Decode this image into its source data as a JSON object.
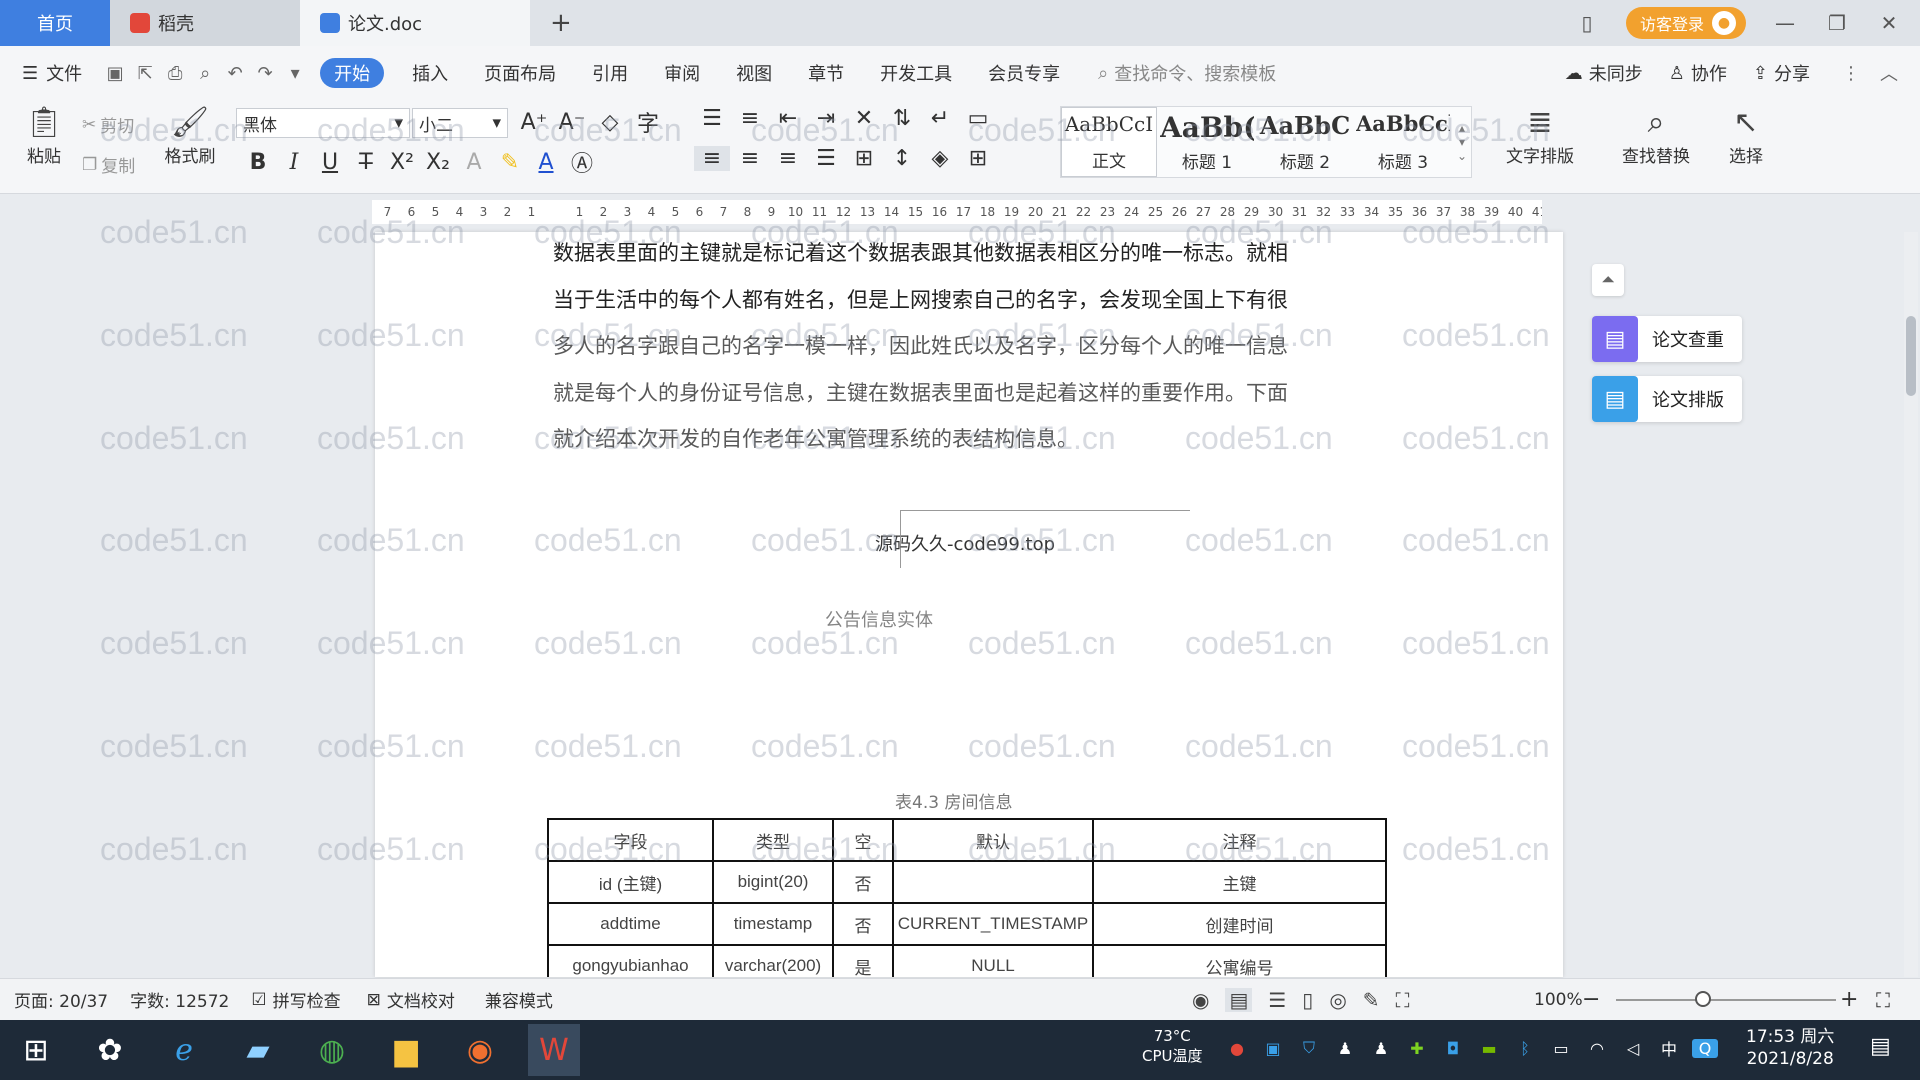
{
  "tabs": {
    "home": "首页",
    "daoke": "稻壳",
    "doc": "论文.doc",
    "add": "+"
  },
  "window": {
    "login": "访客登录"
  },
  "menu": {
    "file": "文件",
    "items": [
      "开始",
      "插入",
      "页面布局",
      "引用",
      "审阅",
      "视图",
      "章节",
      "开发工具",
      "会员专享"
    ],
    "search_placeholder": "查找命令、搜索模板",
    "right": [
      "未同步",
      "协作",
      "分享"
    ]
  },
  "ribbon": {
    "paste": "粘贴",
    "cut": "剪切",
    "copy": "复制",
    "format_painter": "格式刷",
    "font_name": "黑体",
    "font_size": "小二",
    "styles": [
      {
        "preview": "AaBbCcI",
        "label": "正文"
      },
      {
        "preview": "AaBb(",
        "label": "标题 1"
      },
      {
        "preview": "AaBbC",
        "label": "标题 2"
      },
      {
        "preview": "AaBbCcl",
        "label": "标题 3"
      }
    ],
    "text_layout": "文字排版",
    "find_replace": "查找替换",
    "select": "选择"
  },
  "ruler": {
    "ticks": [
      "7",
      "6",
      "5",
      "4",
      "3",
      "2",
      "1",
      "",
      "1",
      "2",
      "3",
      "4",
      "5",
      "6",
      "7",
      "8",
      "9",
      "10",
      "11",
      "12",
      "13",
      "14",
      "15",
      "16",
      "17",
      "18",
      "19",
      "20",
      "21",
      "22",
      "23",
      "24",
      "25",
      "26",
      "27",
      "28",
      "29",
      "30",
      "31",
      "32",
      "33",
      "34",
      "35",
      "36",
      "37",
      "38",
      "39",
      "40",
      "41"
    ]
  },
  "document": {
    "lines": [
      "数据表里面的主键就是标记着这个数据表跟其他数据表相区分的唯一标志。就相",
      "当于生活中的每个人都有姓名，但是上网搜索自己的名字，会发现全国上下有很",
      "多人的名字跟自己的名字一模一样，因此姓氏以及名字，区分每个人的唯一信息",
      "就是每个人的身份证号信息，主键在数据表里面也是起着这样的重要作用。下面",
      "就介绍本次开发的自作老年公寓管理系统的表结构信息。"
    ],
    "image_caption": "源码久久-code99.top",
    "figure_caption": "公告信息实体",
    "table_caption": "表4.3 房间信息",
    "table": {
      "headers": [
        "字段",
        "类型",
        "空",
        "默认",
        "注释"
      ],
      "rows": [
        [
          "id (主键)",
          "bigint(20)",
          "否",
          "",
          "主键"
        ],
        [
          "addtime",
          "timestamp",
          "否",
          "CURRENT_TIMESTAMP",
          "创建时间"
        ],
        [
          "gongyubianhao",
          "varchar(200)",
          "是",
          "NULL",
          "公寓编号"
        ]
      ]
    }
  },
  "sidepanel": {
    "check": "论文查重",
    "layout": "论文排版"
  },
  "status": {
    "page": "页面: 20/37",
    "words": "字数: 12572",
    "spellcheck": "拼写检查",
    "proofread": "文档校对",
    "compat": "兼容模式",
    "zoom": "100%"
  },
  "taskbar": {
    "temp": "73°C",
    "cpu": "CPU温度",
    "ime": "中",
    "time": "17:53 周六",
    "date": "2021/8/28"
  },
  "watermark": "code51.cn",
  "colors": {
    "accent": "#3f7fe0",
    "login": "#f2a12e",
    "check_icon": "#7b6cf0",
    "layout_icon": "#3aa0e8"
  }
}
